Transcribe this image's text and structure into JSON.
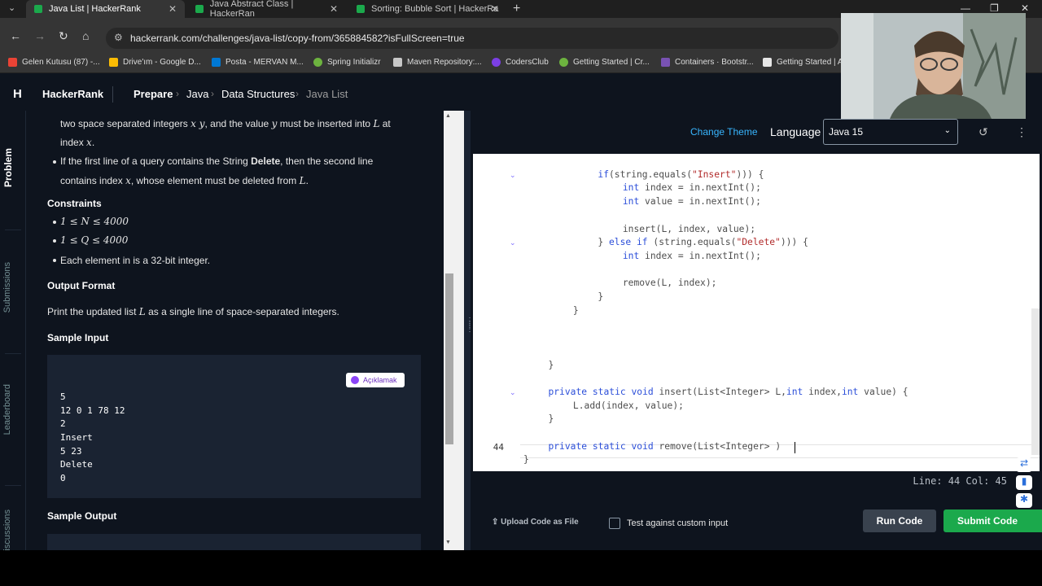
{
  "browser": {
    "tabs": [
      {
        "label": "Java List | HackerRank",
        "active": true
      },
      {
        "label": "Java Abstract Class | HackerRan",
        "active": false
      },
      {
        "label": "Sorting: Bubble Sort | HackerRa",
        "active": false
      }
    ],
    "url": "hackerrank.com/challenges/java-list/copy-from/365884582?isFullScreen=true",
    "bookmarks": [
      {
        "label": "Gelen Kutusu (87) -...",
        "color": "#ea4335"
      },
      {
        "label": "Drive'ım - Google D...",
        "color": "#fbbc04"
      },
      {
        "label": "Posta - MERVAN M...",
        "color": "#0078d4"
      },
      {
        "label": "Spring Initializr",
        "color": "#6db33f"
      },
      {
        "label": "Maven Repository:...",
        "color": "#c7c7c7"
      },
      {
        "label": "CodersClub",
        "color": "#7b3fe4"
      },
      {
        "label": "Getting Started | Cr...",
        "color": "#6db33f"
      },
      {
        "label": "Containers · Bootstr...",
        "color": "#7952b3"
      },
      {
        "label": "Getting Started | A",
        "color": "#e6e6e6"
      }
    ]
  },
  "header": {
    "logo_mark": "H",
    "logo": "HackerRank",
    "breadcrumbs": [
      "Prepare",
      "Java",
      "Data Structures",
      "Java List"
    ]
  },
  "rail": {
    "tabs": [
      "Problem",
      "Submissions",
      "Leaderboard",
      "Discussions"
    ]
  },
  "problem": {
    "line1a": "two space separated integers",
    "line1_xy": "x y",
    "line1b": ", and the value",
    "line1_y": "y",
    "line1c": "must be inserted into",
    "line1_L": "L",
    "line1d": "at",
    "line2a": "index",
    "line2_x": "x",
    "line3a": "If the first line of a query contains the String",
    "line3_bold": "Delete",
    "line3b": ", then the second line",
    "line4a": "contains index",
    "line4_x": "x",
    "line4b": ", whose element must be deleted from",
    "line4_L": "L",
    "constraints_heading": "Constraints",
    "constraints": [
      "1 ≤ N ≤ 4000",
      "1 ≤ Q ≤ 4000",
      "Each element in is a 32-bit integer."
    ],
    "output_heading": "Output Format",
    "output_a": "Print the updated list",
    "output_L": "L",
    "output_b": "as a single line of space-separated integers.",
    "sample_input_heading": "Sample Input",
    "sample_input": [
      "5",
      "12 0 1 78 12",
      "2",
      "Insert",
      "5 23",
      "Delete",
      "0"
    ],
    "ai_badge": "Açıklamak",
    "sample_output_heading": "Sample Output"
  },
  "editor": {
    "change_theme": "Change Theme",
    "language_label": "Language",
    "language": "Java 15",
    "current_line_number": "44",
    "code": [
      {
        "indent": 0,
        "text": ""
      },
      {
        "indent": 12,
        "parts": [
          [
            "kw",
            "if"
          ],
          [
            "",
            "(string.equals("
          ],
          [
            "str",
            "\"Insert\""
          ],
          [
            "",
            "))) {"
          ]
        ]
      },
      {
        "indent": 16,
        "parts": [
          [
            "kw",
            "int"
          ],
          [
            "",
            " index = in.nextInt();"
          ]
        ]
      },
      {
        "indent": 16,
        "parts": [
          [
            "kw",
            "int"
          ],
          [
            "",
            " value = in.nextInt();"
          ]
        ]
      },
      {
        "indent": 0,
        "text": ""
      },
      {
        "indent": 16,
        "text": "insert(L, index, value);"
      },
      {
        "indent": 12,
        "parts": [
          [
            "",
            "} "
          ],
          [
            "kw",
            "else if"
          ],
          [
            "",
            " (string.equals("
          ],
          [
            "str",
            "\"Delete\""
          ],
          [
            "",
            "))) {"
          ]
        ]
      },
      {
        "indent": 16,
        "parts": [
          [
            "kw",
            "int"
          ],
          [
            "",
            " index = in.nextInt();"
          ]
        ]
      },
      {
        "indent": 0,
        "text": ""
      },
      {
        "indent": 16,
        "text": "remove(L, index);"
      },
      {
        "indent": 12,
        "text": "}"
      },
      {
        "indent": 8,
        "text": "}"
      },
      {
        "indent": 0,
        "text": ""
      },
      {
        "indent": 0,
        "text": ""
      },
      {
        "indent": 0,
        "text": ""
      },
      {
        "indent": 4,
        "text": "}"
      },
      {
        "indent": 0,
        "text": ""
      },
      {
        "indent": 4,
        "parts": [
          [
            "kw",
            "private static void"
          ],
          [
            "",
            " insert(List<Integer> L,"
          ],
          [
            "kw",
            "int"
          ],
          [
            "",
            " index,"
          ],
          [
            "kw",
            "int"
          ],
          [
            "",
            " value) {"
          ]
        ]
      },
      {
        "indent": 8,
        "text": "L.add(index, value);"
      },
      {
        "indent": 4,
        "text": "}"
      },
      {
        "indent": 0,
        "text": ""
      },
      {
        "indent": 4,
        "parts": [
          [
            "kw",
            "private static void"
          ],
          [
            "",
            " remove(List<Integer> )"
          ]
        ]
      },
      {
        "indent": 0,
        "text": "}"
      }
    ],
    "status": "Line: 44 Col: 45",
    "upload": "Upload Code as File",
    "test_custom": "Test against custom input",
    "run": "Run Code",
    "submit": "Submit Code"
  }
}
